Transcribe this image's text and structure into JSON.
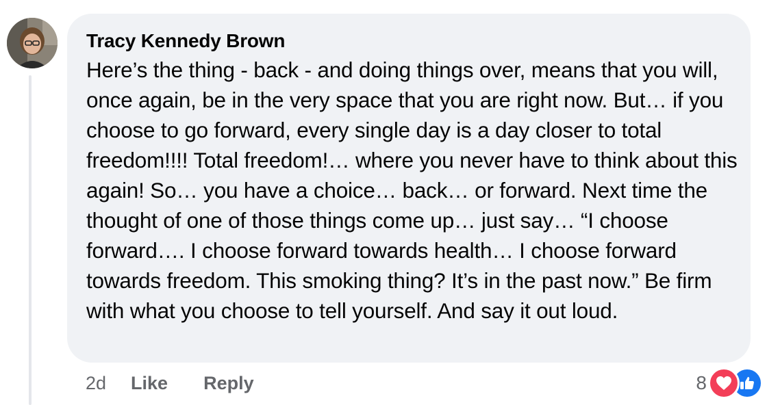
{
  "comment": {
    "author": "Tracy Kennedy Brown",
    "text": "Here’s the thing - back - and doing things over, means that you will, once again, be in the very space that you are right now. But… if you choose to go forward, every single day is a day closer to total freedom!!!! Total freedom!… where you never have to think about this again! So… you have a choice… back… or forward. Next time the thought of one of those things come up… just say… “I choose forward…. I choose forward towards health… I choose forward towards freedom. This smoking thing? It’s in the past now.” Be firm with what you choose to tell yourself. And say it out loud.",
    "timestamp": "2d",
    "like_label": "Like",
    "reply_label": "Reply",
    "reaction_count": "8",
    "reactions": [
      "love-icon",
      "like-icon"
    ]
  },
  "colors": {
    "bubble": "#f0f2f5",
    "text": "#050505",
    "secondary": "#65676b",
    "love": "#f33e58",
    "like": "#1877f2"
  }
}
